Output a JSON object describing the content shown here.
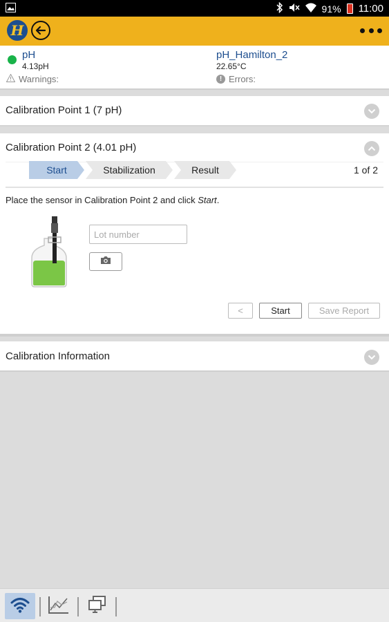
{
  "status_bar": {
    "battery": "91%",
    "time": "11:00",
    "icons": [
      "image-icon",
      "bluetooth-icon",
      "mute-icon",
      "wifi-icon",
      "battery-icon"
    ]
  },
  "app_bar": {
    "logo_letter": "H",
    "icons": [
      "hamilton-logo",
      "back-icon",
      "more-icon"
    ]
  },
  "sensor": {
    "parameter": "pH",
    "value": "4.13pH",
    "warnings_label": "Warnings:",
    "sensor_name": "pH_Hamilton_2",
    "temperature": "22.65°C",
    "errors_label": "Errors:",
    "status_color": "#19b34a"
  },
  "panels": {
    "cp1": {
      "title": "Calibration Point 1 (7 pH)"
    },
    "cp2": {
      "title": "Calibration Point 2 (4.01 pH)",
      "steps": [
        "Start",
        "Stabilization",
        "Result"
      ],
      "active_step": "Start",
      "page_count": "1 of 2",
      "instruction_prefix": "Place the sensor in Calibration Point 2 and click ",
      "instruction_action": "Start",
      "instruction_suffix": ".",
      "lot_placeholder": "Lot number",
      "prev_label": "<",
      "start_label": "Start",
      "save_label": "Save Report"
    },
    "info": {
      "title": "Calibration Information"
    }
  },
  "bottom_nav": {
    "items": [
      "wifi-tab",
      "chart-tab",
      "windows-tab"
    ],
    "active": "wifi-tab"
  },
  "colors": {
    "app_bar": "#efb11c",
    "brand_blue": "#1d4e8f",
    "active_step": "#b9cde6"
  }
}
